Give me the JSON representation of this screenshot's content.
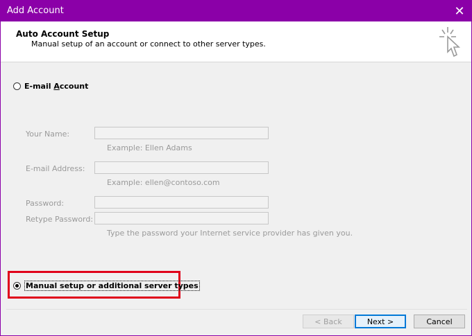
{
  "window": {
    "title": "Add Account",
    "close_glyph": "✕",
    "accent": "#8b00a8"
  },
  "header": {
    "title": "Auto Account Setup",
    "subtitle": "Manual setup of an account or connect to other server types.",
    "icon": "sparkle-cursor-icon"
  },
  "options": {
    "email_account": {
      "label_pre": "E-mail ",
      "label_ul": "A",
      "label_post": "ccount",
      "selected": false
    },
    "manual_setup": {
      "label": "Manual setup or additional server types",
      "selected": true
    }
  },
  "form": {
    "your_name": {
      "label": "Your Name:",
      "value": "",
      "example": "Example: Ellen Adams"
    },
    "email_address": {
      "label": "E-mail Address:",
      "value": "",
      "example": "Example: ellen@contoso.com"
    },
    "password": {
      "label": "Password:",
      "value": ""
    },
    "retype_password": {
      "label": "Retype Password:",
      "value": "",
      "hint": "Type the password your Internet service provider has given you."
    }
  },
  "buttons": {
    "back": "< Back",
    "next": "Next >",
    "cancel": "Cancel"
  },
  "colors": {
    "highlight": "#e0001a",
    "primary_border": "#0078d7"
  }
}
